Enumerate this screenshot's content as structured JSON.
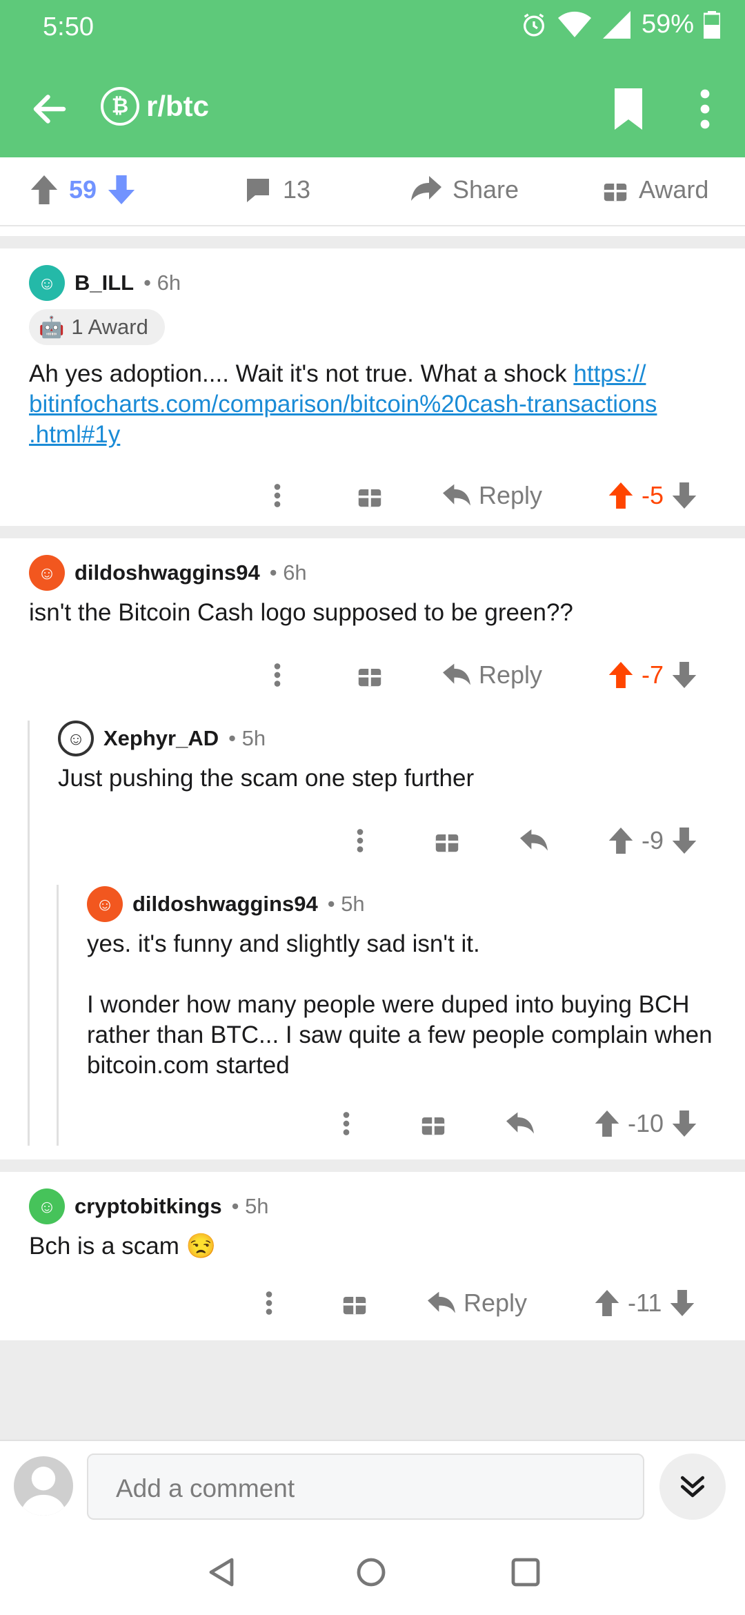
{
  "status": {
    "time": "5:50",
    "battery": "59%"
  },
  "toolbar": {
    "subreddit": "r/btc",
    "back_icon": "arrow-left-icon",
    "bookmark_icon": "bookmark-icon",
    "more_icon": "more-vert-icon"
  },
  "post_bar": {
    "score": "59",
    "comments": "13",
    "share": "Share",
    "award": "Award"
  },
  "comments": [
    {
      "user": "B_ILL",
      "time": "6h",
      "award": "1 Award",
      "text": "Ah yes adoption.... Wait it's not true. What a shock ",
      "link": "https:// bitinfocharts.com/comparison/bitcoin%20cash-transactions .html#1y",
      "reply": "Reply",
      "score": "-5"
    },
    {
      "user": "dildoshwaggins94",
      "time": "6h",
      "text": "isn't the Bitcoin Cash logo supposed to be green??",
      "reply": "Reply",
      "score": "-7"
    },
    {
      "user": "Xephyr_AD",
      "time": "5h",
      "text": "Just pushing the scam one step further",
      "score": "-9"
    },
    {
      "user": "dildoshwaggins94",
      "time": "5h",
      "text1": "yes. it's funny and slightly sad isn't it.",
      "text2": "I wonder how many people were duped into buying BCH rather than BTC... I saw quite a few people complain when bitcoin.com started",
      "score": "-10"
    },
    {
      "user": "cryptobitkings",
      "time": "5h",
      "text": "Bch is a scam 😒",
      "reply": "Reply",
      "score": "-11"
    }
  ],
  "composer": {
    "placeholder": "Add a comment"
  },
  "colors": {
    "header": "#5ec97a",
    "upvote_active": "#ff4500",
    "downvote_active": "#7193ff",
    "link": "#1a8bd6"
  }
}
